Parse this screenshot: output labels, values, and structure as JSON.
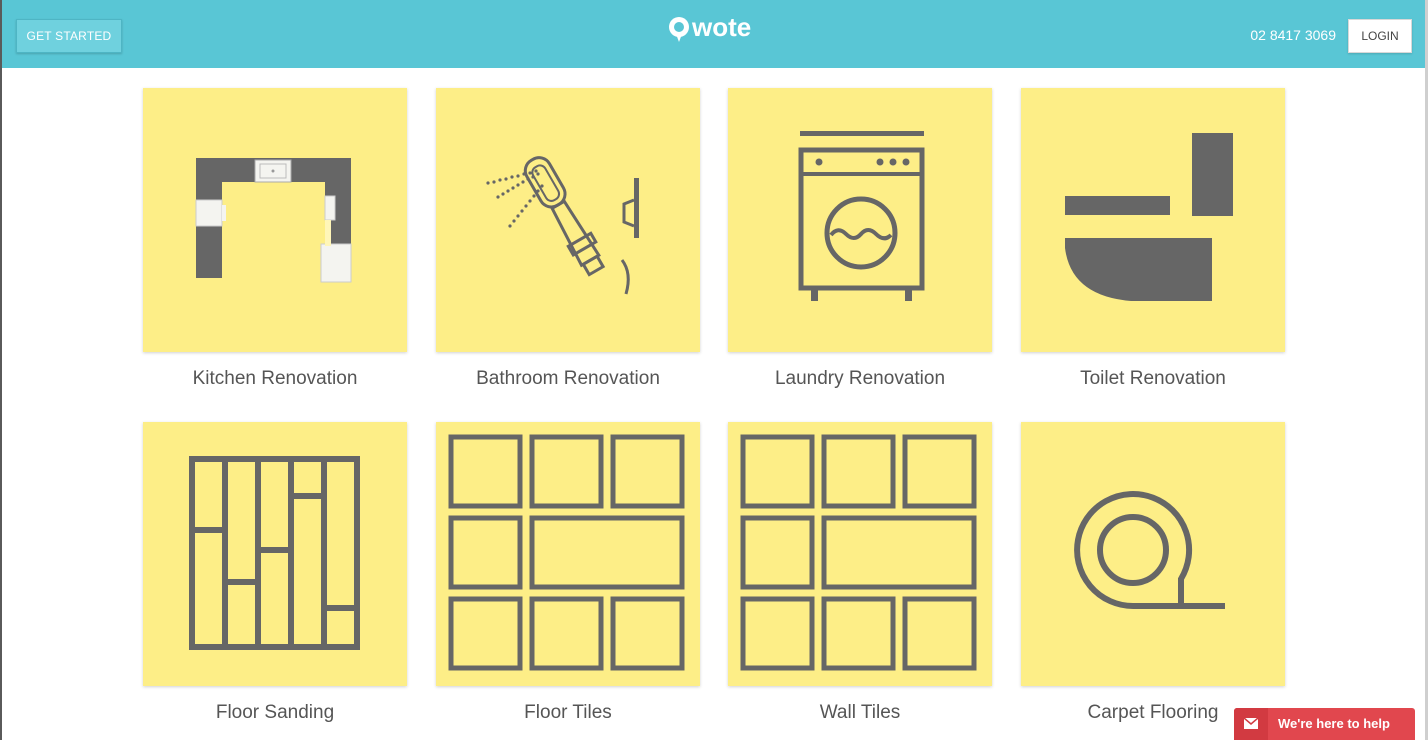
{
  "header": {
    "get_started_label": "GET STARTED",
    "logo_text": "Qwote",
    "phone": "02 8417 3069",
    "login_label": "LOGIN"
  },
  "services": [
    {
      "label": "Kitchen Renovation",
      "icon": "kitchen-layout-icon"
    },
    {
      "label": "Bathroom Renovation",
      "icon": "shower-head-icon"
    },
    {
      "label": "Laundry Renovation",
      "icon": "washing-machine-icon"
    },
    {
      "label": "Toilet Renovation",
      "icon": "toilet-icon"
    },
    {
      "label": "Floor Sanding",
      "icon": "floor-boards-icon"
    },
    {
      "label": "Floor Tiles",
      "icon": "floor-tiles-icon"
    },
    {
      "label": "Wall Tiles",
      "icon": "wall-tiles-icon"
    },
    {
      "label": "Carpet Flooring",
      "icon": "carpet-roll-icon"
    }
  ],
  "help_widget": {
    "label": "We're here to help",
    "icon": "envelope-icon"
  },
  "colors": {
    "header_bg": "#59c6d5",
    "tile_bg": "#fdee87",
    "icon_gray": "#666666",
    "help_red": "#e1474e"
  }
}
